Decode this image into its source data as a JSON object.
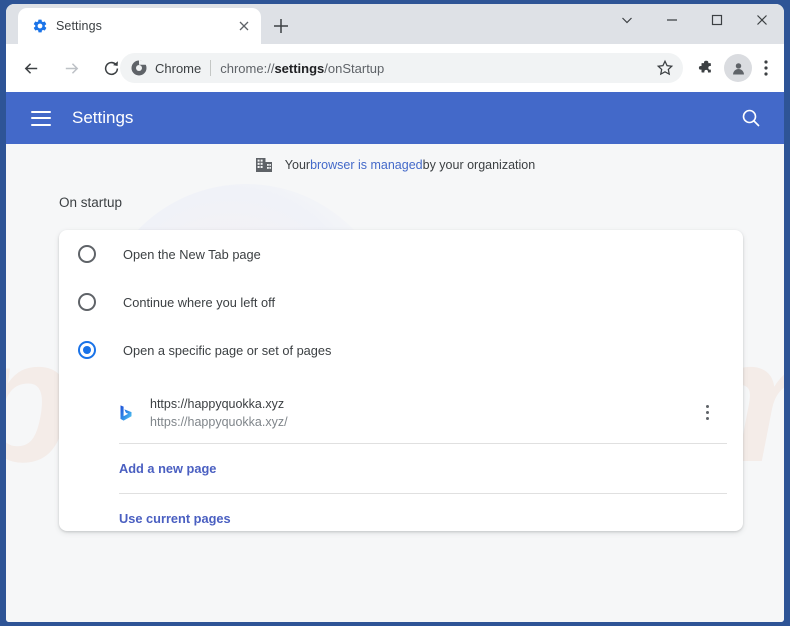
{
  "window": {
    "frame_color": "#2e5496",
    "tabstrip_bg": "#dee1e6",
    "caption_buttons": [
      {
        "name": "tab-search-caption",
        "glyph": "chevron-down-icon"
      },
      {
        "name": "minimize",
        "glyph": "minimize-icon"
      },
      {
        "name": "maximize",
        "glyph": "maximize-icon"
      },
      {
        "name": "close",
        "glyph": "close-icon"
      }
    ]
  },
  "tab": {
    "title": "Settings",
    "favicon": "settings-gear-icon",
    "close_icon": "close-icon",
    "new_tab_icon": "plus-icon"
  },
  "toolbar": {
    "back_icon": "back-arrow-icon",
    "forward_icon": "forward-arrow-icon",
    "reload_icon": "reload-icon",
    "omnibox": {
      "chrome_icon": "chrome-logo-icon",
      "chrome_label": "Chrome",
      "url_prefix": "chrome://",
      "url_bold": "settings",
      "url_suffix": "/onStartup",
      "full_url": "chrome://settings/onStartup"
    },
    "bookmark_icon": "star-icon",
    "extensions_icon": "puzzle-piece-icon",
    "profile_icon": "person-avatar-icon",
    "menu_icon": "three-dot-menu-icon"
  },
  "settings_header": {
    "menu_icon": "hamburger-menu-icon",
    "title": "Settings",
    "search_icon": "search-icon",
    "bg_color": "#4369c9"
  },
  "managed_notice": {
    "icon": "office-building-icon",
    "prefix": "Your ",
    "link": "browser is managed",
    "suffix": " by your organization",
    "link_color": "#4369c9"
  },
  "main": {
    "section_title": "On startup",
    "options": [
      {
        "label": "Open the New Tab page",
        "selected": false
      },
      {
        "label": "Continue where you left off",
        "selected": false
      },
      {
        "label": "Open a specific page or set of pages",
        "selected": true
      }
    ],
    "startup_pages": [
      {
        "favicon": "bing-b-logo-icon",
        "title": "https://happyquokka.xyz",
        "subtitle": "https://happyquokka.xyz/",
        "more_icon": "three-dot-menu-icon"
      }
    ],
    "actions": [
      {
        "label": "Add a new page"
      },
      {
        "label": "Use current pages"
      }
    ],
    "accent_color": "#1a73e8",
    "link_color": "#4a5fc1"
  },
  "watermark": {
    "text": "pcrisk.com"
  }
}
